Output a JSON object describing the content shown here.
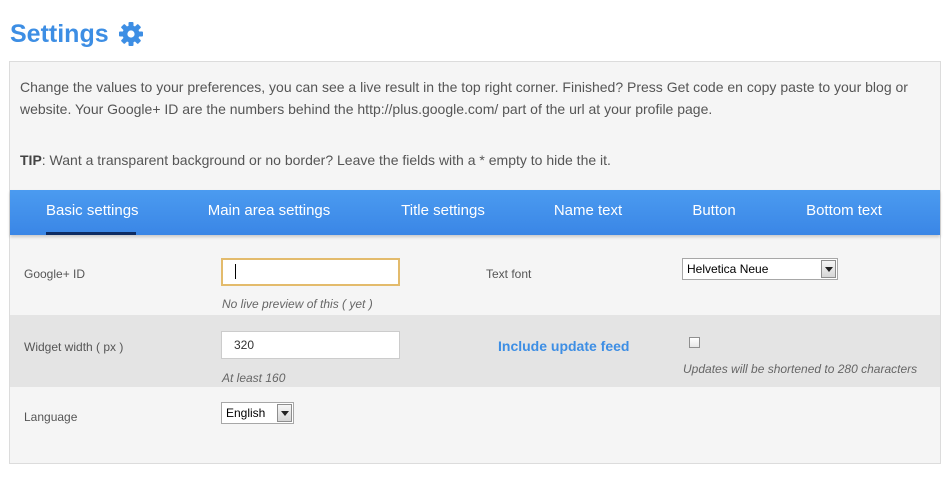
{
  "header": {
    "title": "Settings",
    "icon": "gear-icon",
    "accent_color": "#3d8ee4"
  },
  "intro": {
    "text": "Change the values to your preferences, you can see a live result in the top right corner. Finished? Press Get code en copy paste to your blog or website. Your Google+ ID are the numbers behind the http://plus.google.com/ part of the url at your profile page.",
    "tip_label": "TIP",
    "tip_text": ": Want a transparent background or no border? Leave the fields with a * empty to hide the it."
  },
  "tabs": [
    {
      "label": "Basic settings",
      "active": true
    },
    {
      "label": "Main area settings",
      "active": false
    },
    {
      "label": "Title settings",
      "active": false
    },
    {
      "label": "Name text",
      "active": false
    },
    {
      "label": "Button",
      "active": false
    },
    {
      "label": "Bottom text",
      "active": false
    }
  ],
  "form": {
    "google_id": {
      "label": "Google+ ID",
      "value": "",
      "hint": "No live preview of this ( yet )"
    },
    "text_font": {
      "label": "Text font",
      "selected": "Helvetica Neue"
    },
    "widget_width": {
      "label": "Widget width ( px )",
      "value": "320",
      "hint": "At least 160"
    },
    "update_feed": {
      "label": "Include update feed",
      "checked": false,
      "hint": "Updates will be shortened to 280 characters"
    },
    "language": {
      "label": "Language",
      "selected": "English"
    }
  },
  "colors": {
    "tab_bar": "#3a86e6",
    "active_tab_underline": "#0d2c63",
    "focus_border": "#e3bb6c"
  }
}
